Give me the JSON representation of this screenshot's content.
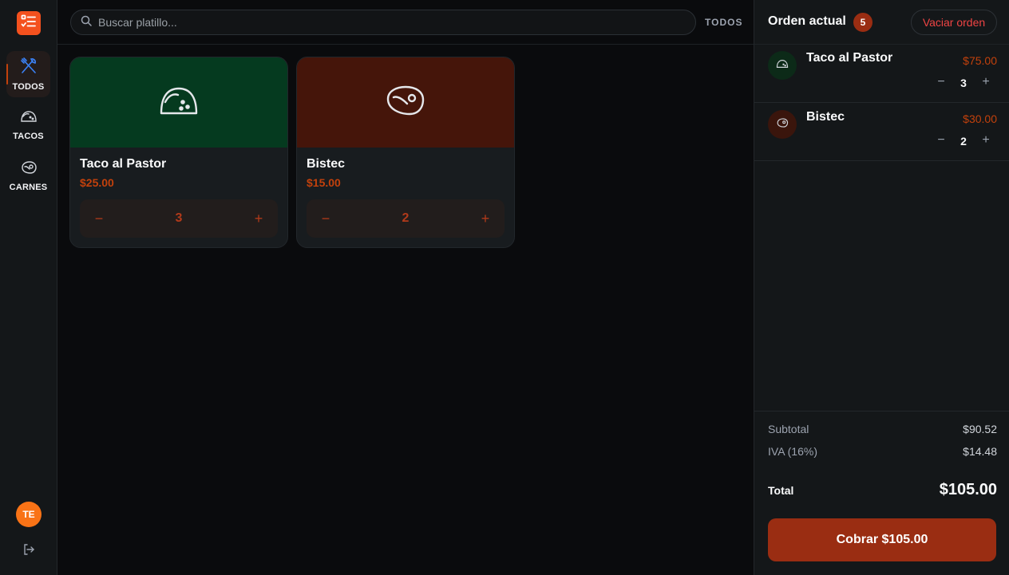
{
  "sidebar": {
    "logo_icon": "menu-list-icon",
    "categories": [
      {
        "label": "TODOS",
        "icon": "utensils-icon",
        "active": true
      },
      {
        "label": "TACOS",
        "icon": "taco-icon",
        "active": false
      },
      {
        "label": "CARNES",
        "icon": "steak-icon",
        "active": false
      }
    ],
    "avatar_initials": "TE",
    "logout_icon": "logout-icon"
  },
  "topbar": {
    "search_placeholder": "Buscar platillo...",
    "filter_label": "TODOS"
  },
  "products": [
    {
      "name": "Taco al Pastor",
      "price": "$25.00",
      "qty": "3",
      "minus": "−",
      "plus": "+",
      "icon": "taco-icon",
      "color": "#053a1f"
    },
    {
      "name": "Bistec",
      "price": "$15.00",
      "qty": "2",
      "minus": "−",
      "plus": "+",
      "icon": "steak-icon",
      "color": "#45150a"
    }
  ],
  "order": {
    "title": "Orden actual",
    "count": "5",
    "clear_label": "Vaciar orden",
    "items": [
      {
        "name": "Taco al Pastor",
        "price": "$75.00",
        "qty": "3",
        "minus": "−",
        "plus": "+",
        "icon": "taco-icon",
        "color": "#0c2a18"
      },
      {
        "name": "Bistec",
        "price": "$30.00",
        "qty": "2",
        "minus": "−",
        "plus": "+",
        "icon": "steak-icon",
        "color": "#3a150c"
      }
    ],
    "subtotal_label": "Subtotal",
    "subtotal": "$90.52",
    "tax_label": "IVA (16%)",
    "tax": "$14.48",
    "total_label": "Total",
    "total": "$105.00",
    "pay_label": "Cobrar $105.00"
  },
  "colors": {
    "accent": "#c2410c",
    "pay_button": "#9a2d12",
    "logo": "#f4511e",
    "active_icon": "#3b82f6"
  }
}
